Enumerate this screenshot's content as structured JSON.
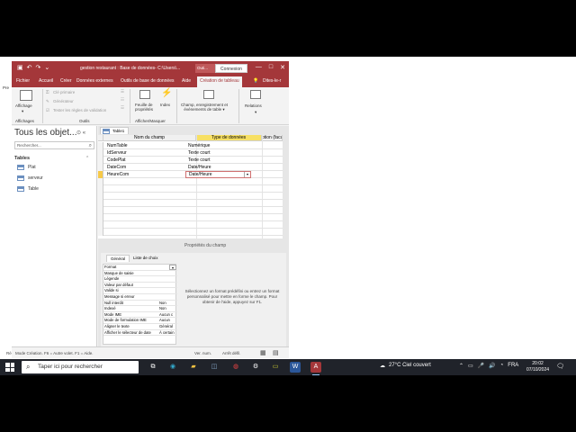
{
  "window": {
    "title": "gestion restaurant : Base de données- C:\\Users\\...",
    "context_label": "Outi...",
    "connexion_label": "Connexion",
    "controls": [
      "—",
      "□",
      "✕"
    ]
  },
  "tabs": [
    "Fichier",
    "Accueil",
    "Créer",
    "Données externes",
    "Outils de base de données",
    "Aide",
    "Création de tableau",
    "Dites-le-r"
  ],
  "ribbon": {
    "affichage": "Affichage",
    "affichages_group": "Affichages",
    "cle_primaire": "Clé primaire",
    "generateur": "Générateur",
    "tester_regles": "Tester les règles de validation",
    "outils_group": "Outils",
    "feuille_proprietes": "Feuille de propriétés",
    "index": "Index",
    "afficher_masquer_group": "Afficher/Masquer",
    "champ_evenements": "Champ, enregistrement et événements de table",
    "relations": "Relations",
    "left_cut": "Pre"
  },
  "nav": {
    "title": "Tous les objet...",
    "search_placeholder": "Rechercher...",
    "category": "Tables",
    "items": [
      "Plat",
      "serveur",
      "Table"
    ]
  },
  "doc": {
    "tab_label": "Table1",
    "headers": [
      "Nom du champ",
      "Type de données",
      "ption (facul"
    ],
    "rows": [
      {
        "name": "NumTable",
        "type": "Numérique"
      },
      {
        "name": "IdServeur",
        "type": "Texte court"
      },
      {
        "name": "CodePlat",
        "type": "Texte court"
      },
      {
        "name": "DateCom",
        "type": "Date/Heure"
      },
      {
        "name": "HeureCom",
        "type": "Date/Heure"
      }
    ],
    "props_title": "Propriétés du champ",
    "props_tabs": [
      "Général",
      "Liste de choix"
    ],
    "props": [
      {
        "label": "Format",
        "value": ""
      },
      {
        "label": "Masque de saisie",
        "value": ""
      },
      {
        "label": "Légende",
        "value": ""
      },
      {
        "label": "Valeur par défaut",
        "value": ""
      },
      {
        "label": "Valide si",
        "value": ""
      },
      {
        "label": "Message si erreur",
        "value": ""
      },
      {
        "label": "Null interdit",
        "value": "Non"
      },
      {
        "label": "Indexé",
        "value": "Non"
      },
      {
        "label": "Mode IME",
        "value": "Aucun c"
      },
      {
        "label": "Mode de formulation IME",
        "value": "Aucun"
      },
      {
        "label": "Aligner le texte",
        "value": "Général"
      },
      {
        "label": "Afficher le sélecteur de date",
        "value": "À certain"
      }
    ],
    "help_text": "Sélectionnez un format prédéfini ou entrez un format personnalisé pour mettre en forme le champ. Pour obtenir de l'aide, appuyez sur F1."
  },
  "status": {
    "left_cut": "Ré",
    "text": "Mode Création. F6 = Autre volet. F1 = Aide.",
    "ver_num": "Ver. num.",
    "arret_defil": "Arrêt défil."
  },
  "taskbar": {
    "search_placeholder": "Taper ici pour rechercher",
    "weather": "27°C  Ciel couvert",
    "lang": "FRA",
    "time": "20:02",
    "date": "07/10/2024"
  }
}
